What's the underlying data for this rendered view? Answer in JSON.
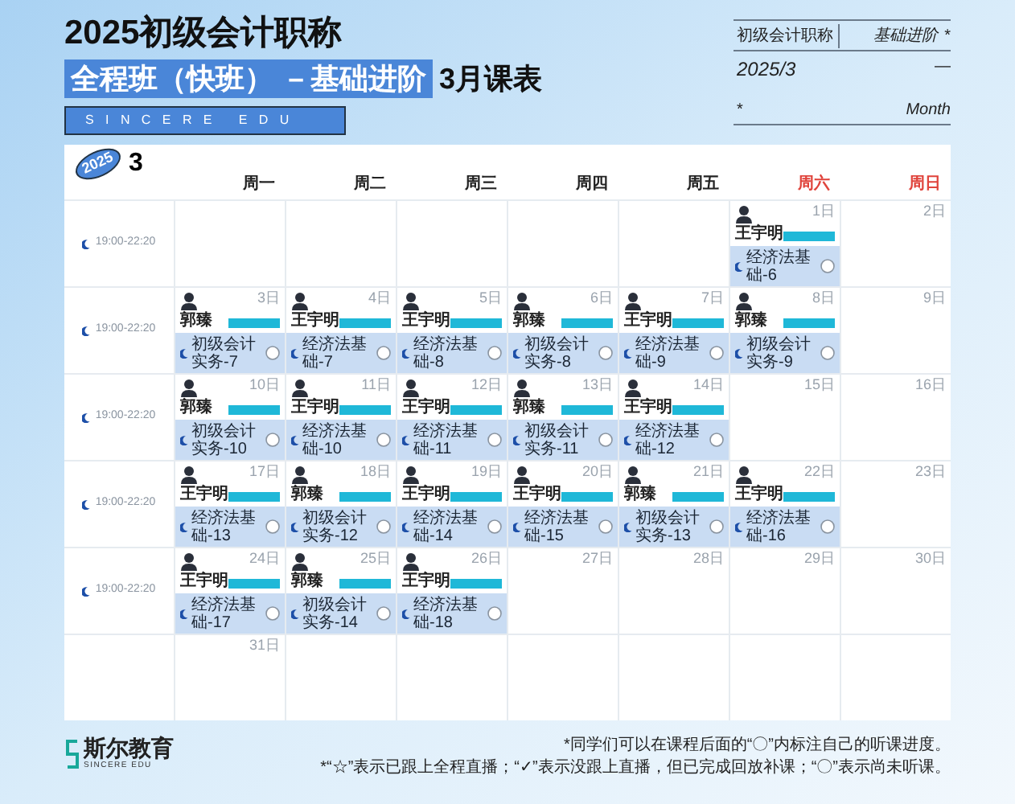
{
  "title": {
    "line1": "2025初级会计职称",
    "highlight": "全程班（快班） －基础进阶",
    "suffix": "3月课表",
    "banner": "SINCERE EDU"
  },
  "info_box": {
    "row1": [
      "初级会计职称",
      "基础进阶",
      "*"
    ],
    "row2": [
      "2025/3",
      "—"
    ],
    "row3": [
      "*",
      "Month"
    ]
  },
  "calendar": {
    "badge_year": "2025",
    "badge_month": "3",
    "weekdays": [
      {
        "label": "周一",
        "weekend": false
      },
      {
        "label": "周二",
        "weekend": false
      },
      {
        "label": "周三",
        "weekend": false
      },
      {
        "label": "周四",
        "weekend": false
      },
      {
        "label": "周五",
        "weekend": false
      },
      {
        "label": "周六",
        "weekend": true
      },
      {
        "label": "周日",
        "weekend": true
      }
    ],
    "weeks": [
      {
        "time": "19:00-22:20",
        "days": [
          {
            "blank": true
          },
          {
            "blank": true
          },
          {
            "blank": true
          },
          {
            "blank": true
          },
          {
            "blank": true
          },
          {
            "date": "1日",
            "session": {
              "teacher": "王宇明",
              "course": "经济法基础-6",
              "marked": false
            }
          },
          {
            "date": "2日"
          }
        ]
      },
      {
        "time": "19:00-22:20",
        "days": [
          {
            "date": "3日",
            "session": {
              "teacher": "郭臻",
              "course": "初级会计实务-7",
              "marked": false
            }
          },
          {
            "date": "4日",
            "session": {
              "teacher": "王宇明",
              "course": "经济法基础-7",
              "marked": false
            }
          },
          {
            "date": "5日",
            "session": {
              "teacher": "王宇明",
              "course": "经济法基础-8",
              "marked": false
            }
          },
          {
            "date": "6日",
            "session": {
              "teacher": "郭臻",
              "course": "初级会计实务-8",
              "marked": false
            }
          },
          {
            "date": "7日",
            "session": {
              "teacher": "王宇明",
              "course": "经济法基础-9",
              "marked": false
            }
          },
          {
            "date": "8日",
            "session": {
              "teacher": "郭臻",
              "course": "初级会计实务-9",
              "marked": false
            }
          },
          {
            "date": "9日"
          }
        ]
      },
      {
        "time": "19:00-22:20",
        "days": [
          {
            "date": "10日",
            "session": {
              "teacher": "郭臻",
              "course": "初级会计实务-10",
              "marked": false
            }
          },
          {
            "date": "11日",
            "session": {
              "teacher": "王宇明",
              "course": "经济法基础-10",
              "marked": false
            }
          },
          {
            "date": "12日",
            "session": {
              "teacher": "王宇明",
              "course": "经济法基础-11",
              "marked": false
            }
          },
          {
            "date": "13日",
            "session": {
              "teacher": "郭臻",
              "course": "初级会计实务-11",
              "marked": false
            }
          },
          {
            "date": "14日",
            "session": {
              "teacher": "王宇明",
              "course": "经济法基础-12",
              "marked": false
            }
          },
          {
            "date": "15日"
          },
          {
            "date": "16日"
          }
        ]
      },
      {
        "time": "19:00-22:20",
        "days": [
          {
            "date": "17日",
            "session": {
              "teacher": "王宇明",
              "course": "经济法基础-13",
              "marked": false
            }
          },
          {
            "date": "18日",
            "session": {
              "teacher": "郭臻",
              "course": "初级会计实务-12",
              "marked": false
            }
          },
          {
            "date": "19日",
            "session": {
              "teacher": "王宇明",
              "course": "经济法基础-14",
              "marked": false
            }
          },
          {
            "date": "20日",
            "session": {
              "teacher": "王宇明",
              "course": "经济法基础-15",
              "marked": false
            }
          },
          {
            "date": "21日",
            "session": {
              "teacher": "郭臻",
              "course": "初级会计实务-13",
              "marked": false
            }
          },
          {
            "date": "22日",
            "session": {
              "teacher": "王宇明",
              "course": "经济法基础-16",
              "marked": false
            }
          },
          {
            "date": "23日"
          }
        ]
      },
      {
        "time": "19:00-22:20",
        "days": [
          {
            "date": "24日",
            "session": {
              "teacher": "王宇明",
              "course": "经济法基础-17",
              "marked": false
            }
          },
          {
            "date": "25日",
            "session": {
              "teacher": "郭臻",
              "course": "初级会计实务-14",
              "marked": false
            }
          },
          {
            "date": "26日",
            "session": {
              "teacher": "王宇明",
              "course": "经济法基础-18",
              "marked": false
            }
          },
          {
            "date": "27日"
          },
          {
            "date": "28日"
          },
          {
            "date": "29日"
          },
          {
            "date": "30日"
          }
        ]
      },
      {
        "days": [
          {
            "date": "31日"
          },
          {
            "blank": true
          },
          {
            "blank": true
          },
          {
            "blank": true
          },
          {
            "blank": true
          },
          {
            "blank": true
          },
          {
            "blank": true
          }
        ]
      }
    ]
  },
  "footer": {
    "logo_name": "斯尔教育",
    "logo_sub": "SINCERE EDU",
    "notes": [
      "*同学们可以在课程后面的“〇”内标注自己的听课进度。",
      "*“☆”表示已跟上全程直播；“✓”表示没跟上直播，但已完成回放补课；“〇”表示尚未听课。"
    ]
  }
}
